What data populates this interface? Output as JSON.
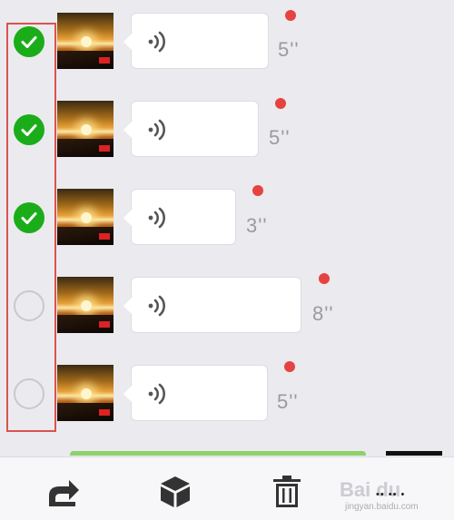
{
  "messages": [
    {
      "duration": "5''",
      "checked": true,
      "type": "voice"
    },
    {
      "duration": "5''",
      "checked": true,
      "type": "voice"
    },
    {
      "duration": "3''",
      "checked": true,
      "type": "voice"
    },
    {
      "duration": "8''",
      "checked": false,
      "type": "voice"
    },
    {
      "duration": "5''",
      "checked": false,
      "type": "voice"
    }
  ],
  "toolbar": {
    "buttons": [
      {
        "name": "forward",
        "icon": "share-forward-icon"
      },
      {
        "name": "favorite",
        "icon": "cube-icon"
      },
      {
        "name": "delete",
        "icon": "trash-icon"
      },
      {
        "name": "more",
        "icon": "more-icon"
      }
    ]
  },
  "watermark": {
    "main": "Bai du",
    "sub": "jingyan.baidu.com",
    "dots": "•• •• •"
  },
  "colors": {
    "check_green": "#1aad19",
    "unread_red": "#e64340",
    "selection_frame": "#d9534f",
    "background": "#ebeaee"
  }
}
